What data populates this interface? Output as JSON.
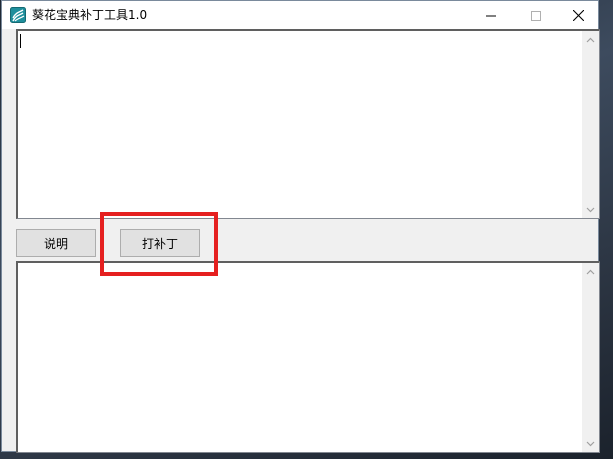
{
  "window": {
    "title": "葵花宝典补丁工具1.0",
    "minimize_icon": "minimize-icon",
    "maximize_icon": "maximize-icon",
    "close_icon": "close-icon"
  },
  "top_textbox": {
    "value": ""
  },
  "bottom_textbox": {
    "value": ""
  },
  "buttons": {
    "help_label": "说明",
    "patch_label": "打补丁"
  },
  "annotation": {
    "color": "#e52020"
  },
  "colors": {
    "window_bg": "#f0f0f0",
    "highlight": "#e52020"
  }
}
